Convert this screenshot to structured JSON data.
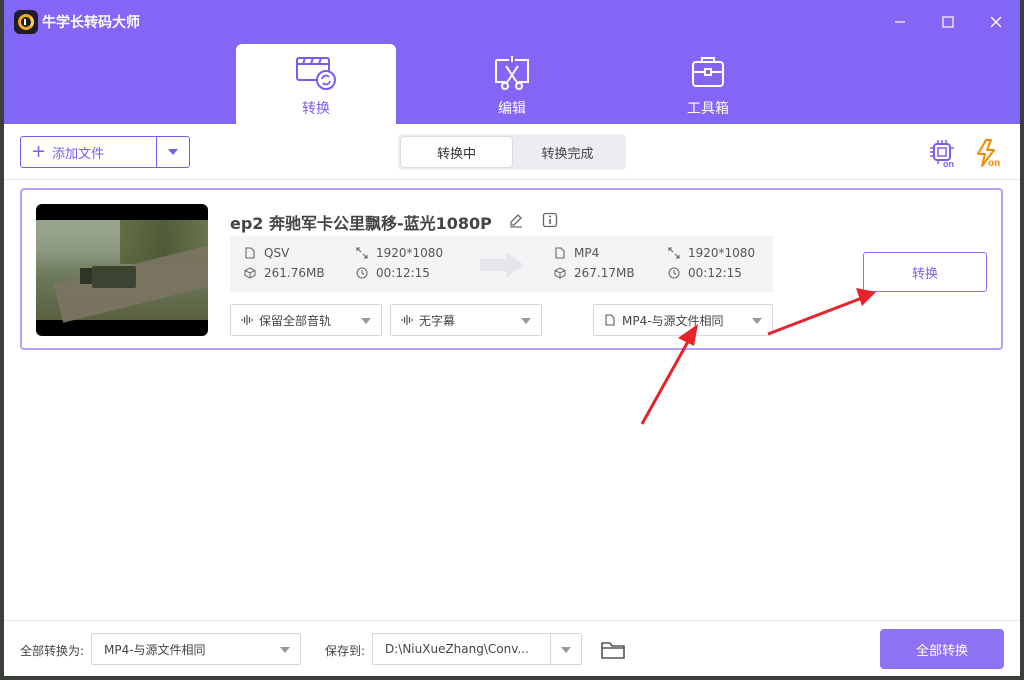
{
  "app": {
    "title": "牛学长转码大师"
  },
  "window_controls": [
    "minimize-icon",
    "maximize-icon",
    "close-icon"
  ],
  "main_tabs": [
    {
      "label": "转换",
      "icon": "film-convert-icon",
      "active": true
    },
    {
      "label": "编辑",
      "icon": "edit-cut-icon",
      "active": false
    },
    {
      "label": "工具箱",
      "icon": "toolbox-icon",
      "active": false
    }
  ],
  "toolbar": {
    "add_file_label": "添加文件",
    "segments": [
      {
        "label": "转换中",
        "active": true
      },
      {
        "label": "转换完成",
        "active": false
      }
    ],
    "right_icons": [
      "hardware-accel-on-icon",
      "speed-boost-on-icon"
    ]
  },
  "file": {
    "title": "ep2 奔驰军卡公里飘移-蓝光1080P",
    "source": {
      "format": "QSV",
      "size": "261.76MB",
      "resolution": "1920*1080",
      "duration": "00:12:15"
    },
    "target": {
      "format": "MP4",
      "size": "267.17MB",
      "resolution": "1920*1080",
      "duration": "00:12:15"
    },
    "audio_track": "保留全部音轨",
    "subtitle": "无字幕",
    "output_format": "MP4-与源文件相同",
    "convert_label": "转换"
  },
  "bottom": {
    "convert_all_to_label": "全部转换为:",
    "convert_all_to_value": "MP4-与源文件相同",
    "save_to_label": "保存到:",
    "save_to_value": "D:\\NiuXueZhang\\Conv...",
    "convert_all_button": "全部转换"
  },
  "colors": {
    "accent": "#8266f5",
    "annotation_arrow": "#e8222a"
  }
}
